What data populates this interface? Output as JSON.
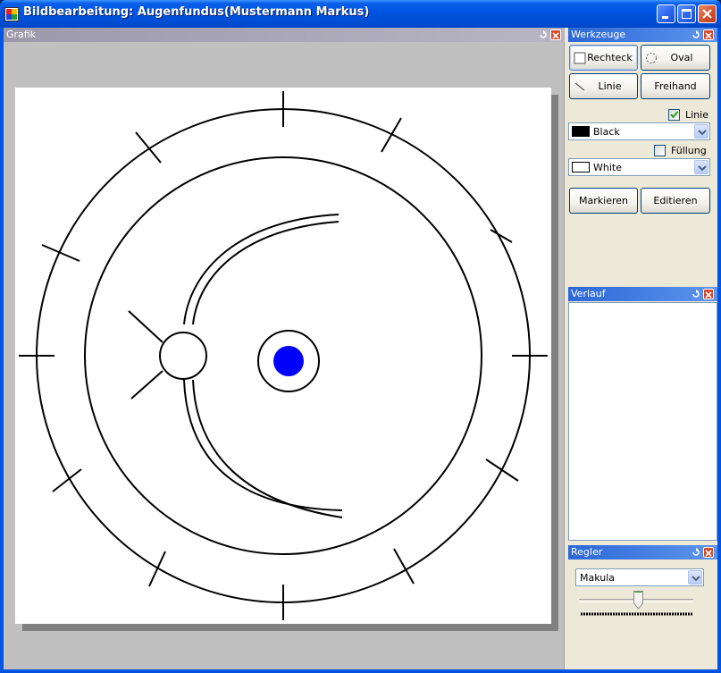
{
  "window": {
    "title": "Bildbearbeitung: Augenfundus(Mustermann Markus)"
  },
  "panes": {
    "grafik": {
      "title": "Grafik"
    },
    "werkzeuge": {
      "title": "Werkzeuge"
    },
    "verlauf": {
      "title": "Verlauf"
    },
    "regler": {
      "title": "Regler"
    }
  },
  "tools": {
    "rechteck": "Rechteck",
    "oval": "Oval",
    "linie": "Linie",
    "freihand": "Freihand",
    "selected": "Rechteck"
  },
  "line_options": {
    "checkbox_label": "Linie",
    "checked": true,
    "color_name": "Black",
    "color_hex": "#000000"
  },
  "fill_options": {
    "checkbox_label": "Füllung",
    "checked": false,
    "color_name": "White",
    "color_hex": "#ffffff"
  },
  "actions": {
    "markieren": "Markieren",
    "editieren": "Editieren"
  },
  "verlauf": {
    "items": []
  },
  "regler": {
    "selected": "Makula",
    "slider_value_fraction": 0.52
  },
  "colors": {
    "macula_fill": "#0000ff"
  },
  "icons": {
    "app": "app-icon",
    "minimize": "minimize-icon",
    "maximize": "maximize-icon",
    "close": "close-icon",
    "pane_restore": "pane-restore-icon",
    "pane_close": "pane-close-icon"
  }
}
